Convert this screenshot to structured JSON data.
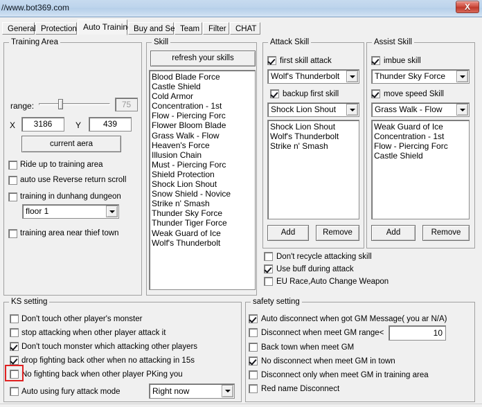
{
  "window": {
    "title": "//www.bot369.com",
    "close_label": "X",
    "close_icon": "close-icon"
  },
  "tabs": [
    {
      "label": "General",
      "active": false
    },
    {
      "label": "Protection",
      "active": false
    },
    {
      "label": "Auto Training",
      "active": true
    },
    {
      "label": "Buy and Sell",
      "active": false
    },
    {
      "label": "Team",
      "active": false
    },
    {
      "label": "Filter",
      "active": false
    },
    {
      "label": "CHAT",
      "active": false
    }
  ],
  "training_area": {
    "legend": "Training Area",
    "range_label": "range:",
    "range_value": "75",
    "range_percent": 30,
    "x_label": "X",
    "x_value": "3186",
    "y_label": "Y",
    "y_value": "439",
    "current_area_button": "current aera",
    "checkboxes": [
      {
        "label": "Ride up to training area",
        "checked": false
      },
      {
        "label": "auto use Reverse return scroll",
        "checked": false
      },
      {
        "label": "training in dunhang dungeon",
        "checked": false
      },
      {
        "label": "training area near thief town",
        "checked": false
      }
    ],
    "floor_combo": "floor 1"
  },
  "skill": {
    "legend": "Skill",
    "refresh_button": "refresh your skills",
    "items": [
      "Blood Blade Force",
      "Castle Shield",
      "Cold Armor",
      "Concentration - 1st",
      "Flow - Piercing Forc",
      "Flower Bloom Blade",
      "Grass Walk - Flow",
      "Heaven's Force",
      "Illusion Chain",
      "Must - Piercing Forc",
      "Shield Protection",
      "Shock Lion Shout",
      "Snow Shield - Novice",
      "Strike n' Smash",
      "Thunder Sky Force",
      "Thunder Tiger Force",
      "Weak Guard of Ice",
      "Wolf's Thunderbolt"
    ]
  },
  "attack_skill": {
    "legend": "Attack Skill",
    "first_skill_checkbox": {
      "label": "first skill attack",
      "checked": true
    },
    "first_skill_combo": "Wolf's Thunderbolt",
    "backup_skill_checkbox": {
      "label": "backup first skill",
      "checked": true
    },
    "backup_skill_combo": "Shock Lion Shout",
    "list": [
      "Shock Lion Shout",
      "Wolf's Thunderbolt",
      "Strike n' Smash"
    ],
    "add_button": "Add",
    "remove_button": "Remove"
  },
  "assist_skill": {
    "legend": "Assist Skill",
    "imbue_checkbox": {
      "label": "imbue skill",
      "checked": true
    },
    "imbue_combo": "Thunder Sky Force",
    "move_speed_checkbox": {
      "label": "move speed Skill",
      "checked": true
    },
    "move_speed_combo": "Grass Walk - Flow",
    "list": [
      "Weak Guard of Ice",
      "Concentration - 1st",
      "Flow - Piercing Forc",
      "Castle Shield"
    ],
    "add_button": "Add",
    "remove_button": "Remove"
  },
  "skill_options": [
    {
      "label": "Don't recycle attacking skill",
      "checked": false
    },
    {
      "label": "Use buff during attack",
      "checked": true
    },
    {
      "label": "EU Race,Auto Change Weapon",
      "checked": false
    }
  ],
  "ks_setting": {
    "legend": "KS setting",
    "checkboxes": [
      {
        "label": "Don't touch other player's monster",
        "checked": false
      },
      {
        "label": "stop attacking when other player attack it",
        "checked": false
      },
      {
        "label": "Don't touch monster which attacking other players",
        "checked": true
      },
      {
        "label": "drop fighting back other when no attacking in 15s",
        "checked": true
      },
      {
        "label": "No fighting back when other player PKing you",
        "checked": false
      },
      {
        "label": "Auto using fury attack mode",
        "checked": false
      }
    ],
    "fury_combo": "Right now",
    "highlight_color": "#e02020"
  },
  "safety_setting": {
    "legend": "safety setting",
    "checkboxes": [
      {
        "label": "Auto disconnect when got GM Message( you ar N/A)",
        "checked": true
      },
      {
        "label": "Disconnect when meet GM range<",
        "checked": false
      },
      {
        "label": "Back town when meet GM",
        "checked": false
      },
      {
        "label": "No disconnect when meet GM in town",
        "checked": true
      },
      {
        "label": "Disconnect only when meet GM in training area",
        "checked": false
      },
      {
        "label": "Red name Disconnect",
        "checked": false
      }
    ],
    "gm_range_value": "10"
  }
}
